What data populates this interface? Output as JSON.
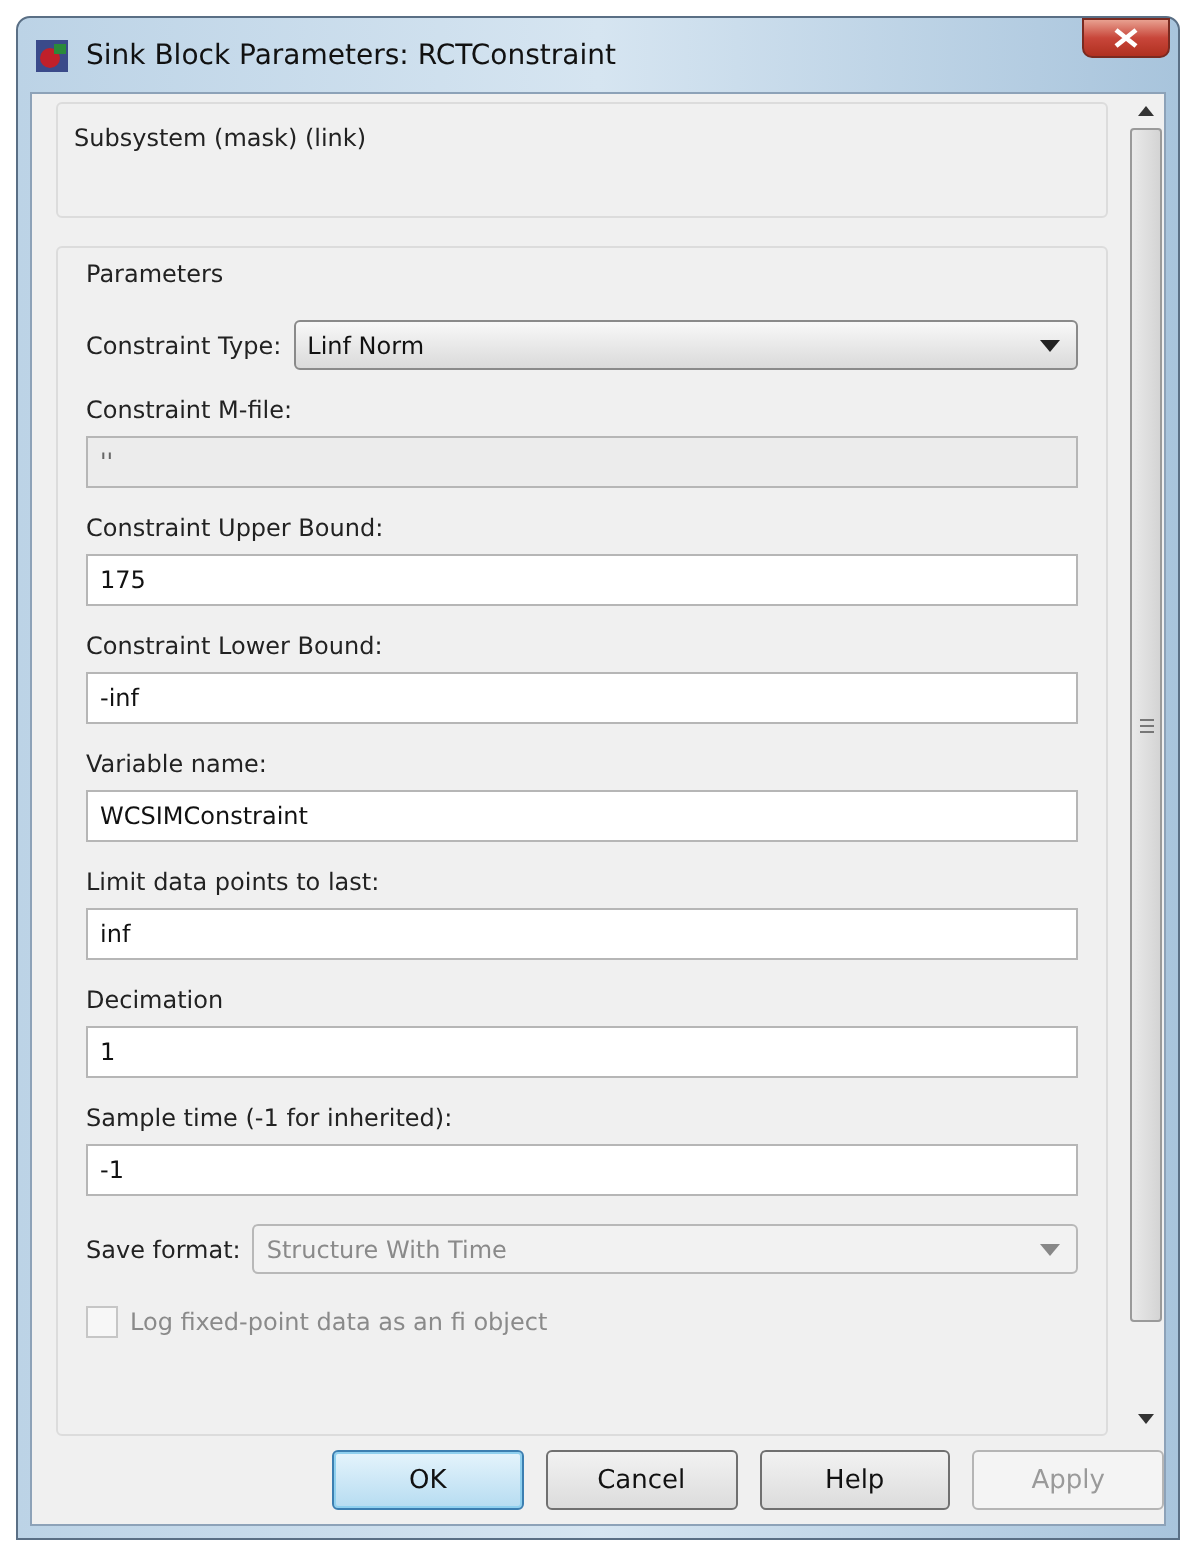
{
  "window": {
    "title": "Sink Block Parameters: RCTConstraint"
  },
  "description_group": {
    "title": "Subsystem (mask) (link)"
  },
  "parameters_group": {
    "title": "Parameters"
  },
  "parameters": [
    {
      "kind": "dropdown",
      "label": "Constraint Type:",
      "value": "Linf Norm",
      "disabled": false
    },
    {
      "kind": "text",
      "label": "Constraint M-file:",
      "value": "''",
      "disabled": true
    },
    {
      "kind": "text",
      "label": "Constraint Upper Bound:",
      "value": "175",
      "disabled": false
    },
    {
      "kind": "text",
      "label": "Constraint Lower Bound:",
      "value": "-inf",
      "disabled": false
    },
    {
      "kind": "text",
      "label": "Variable name:",
      "value": "WCSIMConstraint",
      "disabled": false
    },
    {
      "kind": "text",
      "label": "Limit data points to last:",
      "value": "inf",
      "disabled": false
    },
    {
      "kind": "text",
      "label": "Decimation",
      "value": "1",
      "disabled": false
    },
    {
      "kind": "text",
      "label": "Sample time (-1 for inherited):",
      "value": "-1",
      "disabled": false
    },
    {
      "kind": "dropdown",
      "label": "Save format:",
      "value": "Structure With Time",
      "disabled": true
    },
    {
      "kind": "checkbox",
      "label": "Log fixed-point data as an fi object",
      "checked": false,
      "disabled": true
    }
  ],
  "buttons": [
    {
      "label": "OK",
      "default": true,
      "disabled": false
    },
    {
      "label": "Cancel",
      "default": false,
      "disabled": false
    },
    {
      "label": "Help",
      "default": false,
      "disabled": false
    },
    {
      "label": "Apply",
      "default": false,
      "disabled": true
    }
  ]
}
